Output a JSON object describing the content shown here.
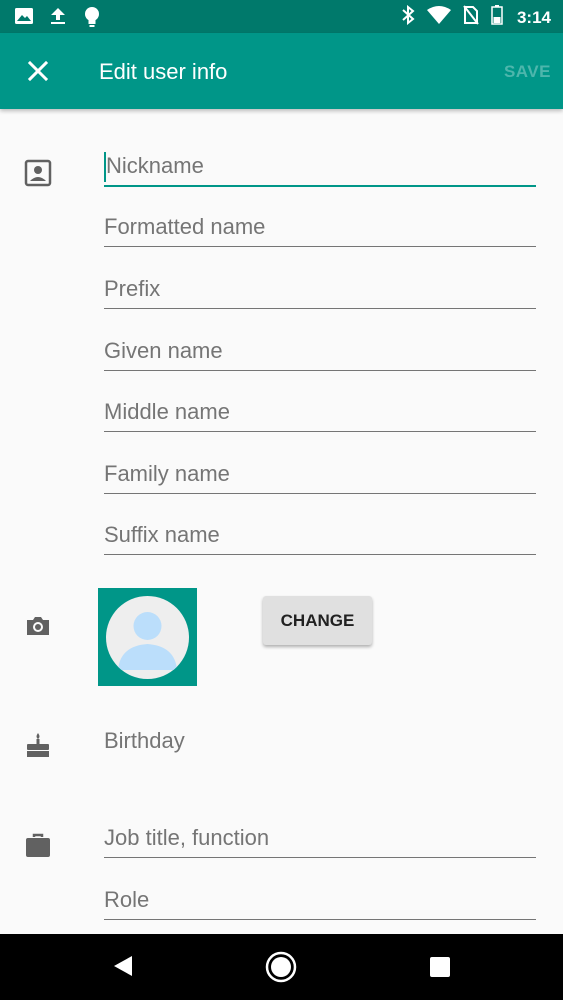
{
  "status_bar": {
    "time": "3:14",
    "left_icons": [
      "image-icon",
      "upload-icon",
      "lightbulb-icon"
    ],
    "right_icons": [
      "bluetooth-icon",
      "wifi-icon",
      "no-sim-icon",
      "battery-icon"
    ]
  },
  "app_bar": {
    "title": "Edit user info",
    "save_label": "SAVE",
    "close_icon": "close-icon"
  },
  "name_fields": [
    {
      "placeholder": "Nickname",
      "focused": true
    },
    {
      "placeholder": "Formatted name"
    },
    {
      "placeholder": "Prefix"
    },
    {
      "placeholder": "Given name"
    },
    {
      "placeholder": "Middle name"
    },
    {
      "placeholder": "Family name"
    },
    {
      "placeholder": "Suffix name"
    }
  ],
  "photo": {
    "change_label": "CHANGE"
  },
  "birthday": {
    "label": "Birthday"
  },
  "work_fields": [
    {
      "placeholder": "Job title, function"
    },
    {
      "placeholder": "Role"
    }
  ],
  "colors": {
    "primary": "#009688",
    "primary_dark": "#00796b",
    "save_disabled": "#4db6ac"
  }
}
